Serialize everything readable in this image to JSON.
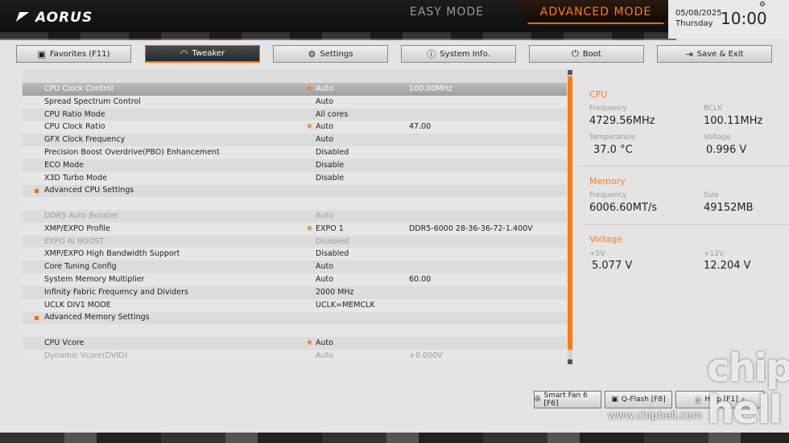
{
  "header": {
    "brand": "AORUS",
    "easy_mode": "EASY MODE",
    "advanced_mode": "ADVANCED MODE",
    "date": "05/08/2025",
    "day": "Thursday",
    "time": "10:00"
  },
  "tabs": [
    {
      "label": "Favorites (F11)",
      "icon": "favorites-icon"
    },
    {
      "label": "Tweaker",
      "icon": "speedometer-icon",
      "active": true
    },
    {
      "label": "Settings",
      "icon": "gear-icon"
    },
    {
      "label": "System Info.",
      "icon": "info-icon"
    },
    {
      "label": "Boot",
      "icon": "power-icon"
    },
    {
      "label": "Save & Exit",
      "icon": "exit-icon"
    }
  ],
  "settings": [
    {
      "name": "CPU Clock Control",
      "star": "★",
      "value": "Auto",
      "value2": "100.00MHz",
      "selected": true
    },
    {
      "name": "Spread Spectrum Control",
      "star": "",
      "value": "Auto",
      "value2": ""
    },
    {
      "name": "CPU Ratio Mode",
      "star": "",
      "value": "All cores",
      "value2": ""
    },
    {
      "name": "CPU Clock Ratio",
      "star": "★",
      "value": "Auto",
      "value2": "47.00"
    },
    {
      "name": "GFX Clock Frequency",
      "star": "",
      "value": "Auto",
      "value2": ""
    },
    {
      "name": "Precision Boost Overdrive(PBO) Enhancement",
      "star": "",
      "value": "Disabled",
      "value2": ""
    },
    {
      "name": "ECO Mode",
      "star": "",
      "value": "Disable",
      "value2": ""
    },
    {
      "name": "X3D Turbo Mode",
      "star": "",
      "value": "Disable",
      "value2": ""
    },
    {
      "name": "Advanced CPU Settings",
      "star": "",
      "value": "",
      "value2": "",
      "submenu": true
    },
    {
      "name": "",
      "star": "",
      "value": "",
      "value2": ""
    },
    {
      "name": "DDR5 Auto Booster",
      "star": "",
      "value": "Auto",
      "value2": "",
      "dim": true
    },
    {
      "name": "XMP/EXPO Profile",
      "star": "★",
      "value": "EXPO 1",
      "value2": "DDR5-6000 28-36-36-72-1.400V"
    },
    {
      "name": "EXPO AI BOOST",
      "star": "",
      "value": "Disabled",
      "value2": "",
      "dim": true
    },
    {
      "name": "XMP/EXPO High Bandwidth Support",
      "star": "",
      "value": "Disabled",
      "value2": ""
    },
    {
      "name": "Core Tuning Config",
      "star": "",
      "value": "Auto",
      "value2": ""
    },
    {
      "name": "System Memory Multiplier",
      "star": "",
      "value": "Auto",
      "value2": "60.00"
    },
    {
      "name": "Infinity Fabric Frequency and Dividers",
      "star": "",
      "value": "2000 MHz",
      "value2": ""
    },
    {
      "name": "UCLK DIV1 MODE",
      "star": "",
      "value": "UCLK=MEMCLK",
      "value2": ""
    },
    {
      "name": "Advanced Memory Settings",
      "star": "",
      "value": "",
      "value2": "",
      "submenu": true
    },
    {
      "name": "",
      "star": "",
      "value": "",
      "value2": ""
    },
    {
      "name": "CPU Vcore",
      "star": "★",
      "value": "Auto",
      "value2": ""
    },
    {
      "name": "Dynamic Vcore(DVID)",
      "star": "",
      "value": "Auto",
      "value2": "+0.000V",
      "dim": true
    }
  ],
  "info": {
    "cpu": {
      "title": "CPU",
      "frequency_label": "Frequency",
      "frequency": "4729.56MHz",
      "bclk_label": "BCLK",
      "bclk": "100.11MHz",
      "temperature_label": "Temperature",
      "temperature": "37.0 °C",
      "voltage_label": "Voltage",
      "voltage": "0.996 V"
    },
    "memory": {
      "title": "Memory",
      "frequency_label": "Frequency",
      "frequency": "6006.60MT/s",
      "size_label": "Size",
      "size": "49152MB"
    },
    "voltage": {
      "title": "Voltage",
      "v5_label": "+5V",
      "v5": "5.077 V",
      "v12_label": "+12V",
      "v12": "12.204 V"
    }
  },
  "bottom": {
    "smart_fan": "Smart Fan 6 [F6]",
    "qflash": "Q-Flash [F8]",
    "help": "Help [F1]"
  },
  "watermark": {
    "url": "www.chiphell.com",
    "logo": "chip hell"
  }
}
